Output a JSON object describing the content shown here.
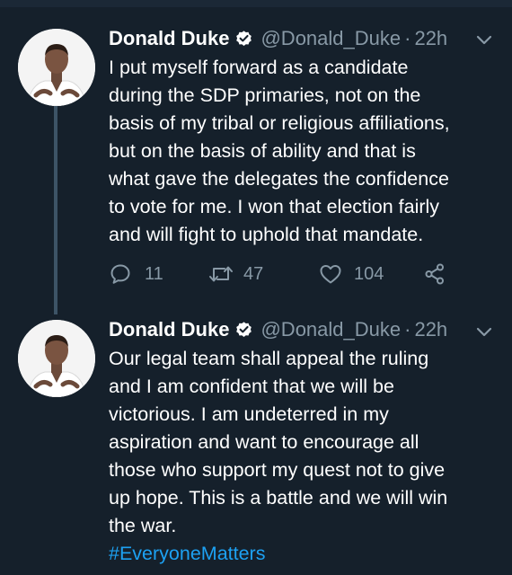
{
  "tweets": [
    {
      "author_name": "Donald Duke",
      "handle": "@Donald_Duke",
      "separator": "·",
      "time": "22h",
      "lines": [
        "I put myself forward as a candidate",
        "during the SDP primaries, not on the",
        "basis of my tribal or religious affiliations,",
        "but on the basis of ability and that is",
        "what gave the delegates the confidence",
        "to vote for me. I won that election fairly",
        "and will fight to uphold that mandate."
      ],
      "reply_count": "11",
      "retweet_count": "47",
      "like_count": "104"
    },
    {
      "author_name": "Donald Duke",
      "handle": "@Donald_Duke",
      "separator": "·",
      "time": "22h",
      "lines": [
        "Our legal team shall  appeal the ruling",
        "and I am confident that we will be",
        "victorious. I am undeterred in my",
        "aspiration and want to encourage all",
        "those who support my quest not to give",
        "up hope. This is a battle and we will win",
        "the war."
      ],
      "hashtag": "#EveryoneMatters"
    }
  ],
  "colors": {
    "background": "#15202b",
    "text": "#ffffff",
    "muted": "#8899a6",
    "link": "#1da1f2",
    "thread_line": "#3d5466"
  },
  "icons": {
    "verified": "verified-badge-icon",
    "more": "chevron-down-icon",
    "reply": "reply-icon",
    "retweet": "retweet-icon",
    "like": "heart-icon",
    "share": "share-icon"
  }
}
